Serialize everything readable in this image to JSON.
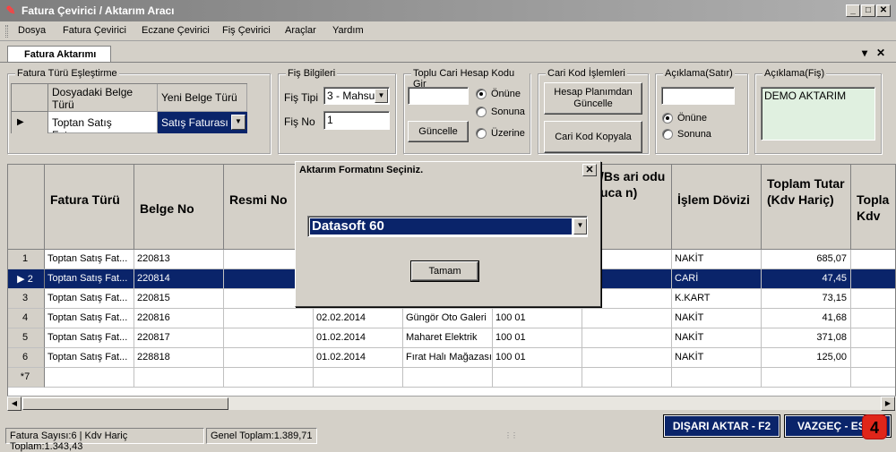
{
  "window": {
    "title": "Fatura Çevirici / Aktarım Aracı",
    "min_glyph": "_",
    "max_glyph": "□",
    "close_glyph": "✕"
  },
  "menu": [
    "Dosya",
    "Fatura Çevirici",
    "Eczane Çevirici",
    "Fiş Çevirici",
    "Araçlar",
    "Yardım"
  ],
  "doc_tab": {
    "label": "Fatura Aktarımı",
    "pin": "▾",
    "close": "✕"
  },
  "fatura_turu": {
    "title": "Fatura Türü Eşleştirme",
    "col1": "Dosyadaki Belge Türü",
    "col2": "Yeni Belge Türü",
    "row_source": "Toptan Satış Faturası",
    "row_target": "Satış Faturası"
  },
  "fis_bilgileri": {
    "title": "Fiş Bilgileri",
    "tip_label": "Fiş Tipi",
    "tip_value": "3 - Mahsu",
    "no_label": "Fiş No",
    "no_value": "1"
  },
  "toplu_cari": {
    "title": "Toplu Cari Hesap Kodu Gir",
    "input_value": "",
    "button": "Güncelle",
    "options": [
      "Önüne",
      "Sonuna",
      "Üzerine"
    ],
    "selected": 0
  },
  "cari_kod": {
    "title": "Cari Kod İşlemleri",
    "btn1": "Hesap Planımdan Güncelle",
    "btn2": "Cari Kod Kopyala"
  },
  "aciklama_satir": {
    "title": "Açıklama(Satır)",
    "input_value": "",
    "options": [
      "Önüne",
      "Sonuna"
    ],
    "selected": 0
  },
  "aciklama_fis": {
    "title": "Açıklama(Fiş)",
    "value": "DEMO AKTARIM"
  },
  "grid": {
    "headers": [
      "Fatura Türü",
      "Belge No",
      "Resmi No",
      "",
      "",
      "/Bs ari odu uca n)",
      "",
      "İşlem Dövizi",
      "Toplam Tutar (Kdv Hariç)",
      "Topla Kdv"
    ],
    "rows": [
      {
        "n": "1",
        "tur": "Toptan Satış Fat...",
        "belge": "220813",
        "tarih": "",
        "cari": "",
        "kod": "",
        "doviz": "NAKİT",
        "tutar": "685,07"
      },
      {
        "n": "2",
        "tur": "Toptan Satış Fat...",
        "belge": "220814",
        "tarih": "",
        "cari": "",
        "kod": "",
        "doviz": "CARİ",
        "tutar": "47,45"
      },
      {
        "n": "3",
        "tur": "Toptan Satış Fat...",
        "belge": "220815",
        "tarih": "",
        "cari": "",
        "kod": "",
        "doviz": "K.KART",
        "tutar": "73,15"
      },
      {
        "n": "4",
        "tur": "Toptan Satış Fat...",
        "belge": "220816",
        "tarih": "02.02.2014",
        "cari": "Güngör Oto Galeri",
        "kod": "100 01",
        "doviz": "NAKİT",
        "tutar": "41,68"
      },
      {
        "n": "5",
        "tur": "Toptan Satış Fat...",
        "belge": "220817",
        "tarih": "01.02.2014",
        "cari": "Maharet Elektrik",
        "kod": "100 01",
        "doviz": "NAKİT",
        "tutar": "371,08"
      },
      {
        "n": "6",
        "tur": "Toptan Satış Fat...",
        "belge": "228818",
        "tarih": "01.02.2014",
        "cari": "Fırat Halı Mağazası",
        "kod": "100 01",
        "doviz": "NAKİT",
        "tutar": "125,00"
      }
    ],
    "new_row": "*7",
    "selected_row": 1
  },
  "modal": {
    "title": "Aktarım Formatını Seçiniz.",
    "format_value": "Datasoft 60",
    "ok_button": "Tamam",
    "close_glyph": "✕"
  },
  "status": {
    "left": "Fatura Sayısı:6 | Kdv Hariç Toplam:1.343,43",
    "right": "Genel Toplam:1.389,71"
  },
  "actions": {
    "export": "DIŞARI AKTAR - F2",
    "cancel": "VAZGEÇ - ES"
  },
  "badge": "4",
  "colors": {
    "selection": "#0a246a",
    "badge": "#e0261a"
  }
}
